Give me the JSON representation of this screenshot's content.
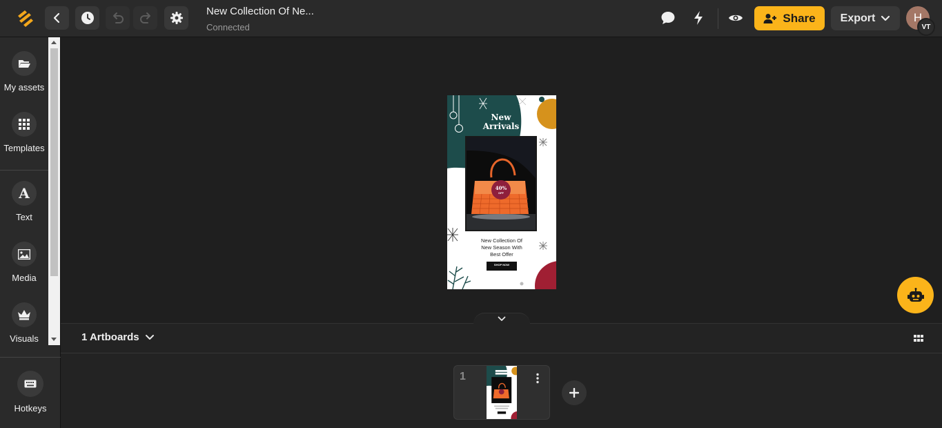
{
  "app": {
    "document_title": "New Collection Of Ne...",
    "status": "Connected",
    "share_label": "Share",
    "export_label": "Export",
    "avatar_initial": "H",
    "avatar_badge": "VT"
  },
  "sidebar": {
    "items": [
      {
        "label": "My assets",
        "icon": "folder-icon"
      },
      {
        "label": "Templates",
        "icon": "grid-icon"
      },
      {
        "label": "Text",
        "icon": "text-icon"
      },
      {
        "label": "Media",
        "icon": "image-icon"
      },
      {
        "label": "Visuals",
        "icon": "crown-icon"
      }
    ],
    "hotkeys_label": "Hotkeys"
  },
  "artboard": {
    "headline_line1": "New",
    "headline_line2": "Arrivals",
    "badge_line1": "40%",
    "badge_line2": "OFF",
    "body_line1": "New Collection Of",
    "body_line2": "New Season With",
    "body_line3": "Best Offer",
    "cta": "SHOP NOW"
  },
  "bottom": {
    "artboards_label": "1 Artboards",
    "thumbnail_number": "1"
  },
  "colors": {
    "accent": "#fbb41a",
    "teal": "#1d4c4b",
    "mustard": "#d6921c",
    "crimson": "#a01f33",
    "bag_orange": "#ee6a2b"
  }
}
